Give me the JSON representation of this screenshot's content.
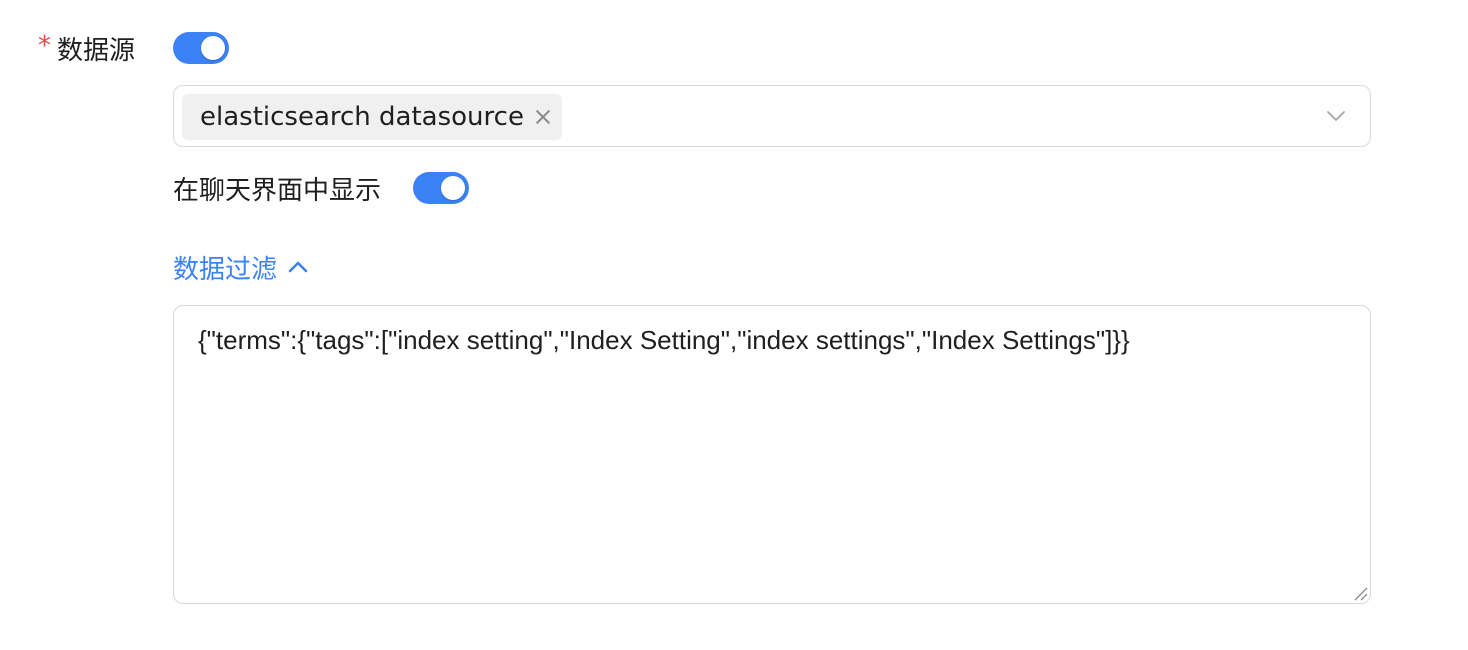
{
  "form": {
    "datasource": {
      "required_mark": "*",
      "label": "数据源",
      "enabled": true,
      "selected_tags": [
        {
          "label": "elasticsearch datasource"
        }
      ]
    },
    "show_in_chat": {
      "label": "在聊天界面中显示",
      "enabled": true
    },
    "data_filter": {
      "toggle_label": "数据过滤",
      "expanded": true,
      "value": "{\"terms\":{\"tags\":[\"index setting\",\"Index Setting\",\"index settings\",\"Index Settings\"]}}"
    }
  },
  "icons": {
    "tag_close": "close-icon",
    "select_arrow": "chevron-down-icon",
    "filter_toggle": "chevron-up-icon",
    "textarea_resize": "resize-handle-icon"
  },
  "colors": {
    "primary": "#3b82f6",
    "required": "#e5484d",
    "border": "#d9d9d9",
    "tag_bg": "#f0f0f0"
  }
}
